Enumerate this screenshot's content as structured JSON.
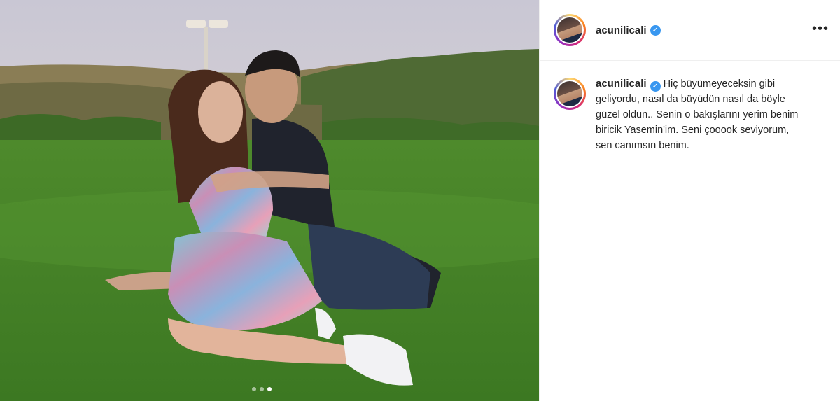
{
  "post": {
    "username": "acunilicali",
    "more_icon": "more-options-icon",
    "verified_icon": "verified-badge-icon",
    "caption": "Hiç büyümeyeceksin gibi geliyordu, nasıl da büyüdün nasıl da böyle güzel oldun.. Senin o bakışlarını yerim benim biricik Yasemin'im. Seni çooook seviyorum, sen canımsın benim.",
    "carousel": {
      "count": 3,
      "active": 3
    }
  },
  "colors": {
    "verified": "#3897f0",
    "text": "#262626",
    "border": "#efefef"
  }
}
